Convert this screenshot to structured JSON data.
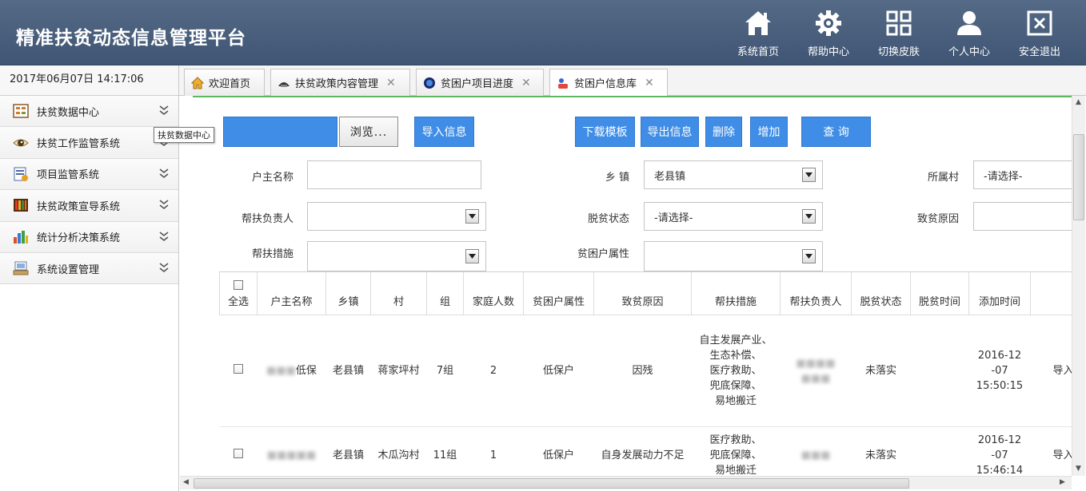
{
  "app": {
    "title": "精准扶贫动态信息管理平台"
  },
  "top_nav": [
    {
      "label": "系统首页",
      "icon": "home-icon"
    },
    {
      "label": "帮助中心",
      "icon": "gear-icon"
    },
    {
      "label": "切换皮肤",
      "icon": "grid-icon"
    },
    {
      "label": "个人中心",
      "icon": "user-icon"
    },
    {
      "label": "安全退出",
      "icon": "close-box-icon"
    }
  ],
  "sidebar": {
    "datetime": "2017年06月07日 14:17:06",
    "items": [
      {
        "label": "扶贫数据中心",
        "icon": "data-center-icon"
      },
      {
        "label": "扶贫工作监管系统",
        "icon": "eye-icon"
      },
      {
        "label": "项目监管系统",
        "icon": "project-icon"
      },
      {
        "label": "扶贫政策宣导系统",
        "icon": "books-icon"
      },
      {
        "label": "统计分析决策系统",
        "icon": "bar-chart-icon"
      },
      {
        "label": "系统设置管理",
        "icon": "settings-icon"
      }
    ],
    "tooltip": "扶贫数据中心"
  },
  "tabs": [
    {
      "label": "欢迎首页",
      "icon": "home-icon",
      "closable": false
    },
    {
      "label": "扶贫政策内容管理",
      "icon": "policy-icon",
      "closable": true
    },
    {
      "label": "贫困户项目进度",
      "icon": "progress-icon",
      "closable": true
    },
    {
      "label": "贫困户信息库",
      "icon": "household-icon",
      "closable": true
    }
  ],
  "toolbar": {
    "browse": "浏览...",
    "import": "导入信息",
    "download_template": "下载模板",
    "export": "导出信息",
    "delete": "删除",
    "add": "增加",
    "query": "查 询"
  },
  "filters": {
    "head_name": {
      "label": "户主名称",
      "value": ""
    },
    "township": {
      "label": "乡 镇",
      "value": "老县镇"
    },
    "village": {
      "label": "所属村",
      "value": "-请选择-"
    },
    "helper": {
      "label": "帮扶负责人",
      "value": ""
    },
    "status": {
      "label": "脱贫状态",
      "value": "-请选择-"
    },
    "cause": {
      "label": "致贫原因",
      "value": ""
    },
    "measures": {
      "label": "帮扶措施",
      "value": ""
    },
    "attribute": {
      "label": "贫困户属性",
      "value": ""
    }
  },
  "table": {
    "headers": [
      "全选",
      "户主名称",
      "乡镇",
      "村",
      "组",
      "家庭人数",
      "贫困户属性",
      "致贫原因",
      "帮扶措施",
      "帮扶负责人",
      "脱贫状态",
      "脱贫时间",
      "添加时间"
    ],
    "rows": [
      {
        "name": "低保",
        "township": "老县镇",
        "village": "蒋家坪村",
        "group": "7组",
        "members": "2",
        "attribute": "低保户",
        "cause": "因残",
        "measures": [
          "自主发展产业、",
          "生态补偿、",
          "医疗救助、",
          "兜底保障、",
          "易地搬迁"
        ],
        "helper": "",
        "status": "未落实",
        "off_time": "",
        "added": [
          "2016-12",
          "-07",
          "15:50:15"
        ],
        "extra": "导入"
      },
      {
        "name": "",
        "township": "老县镇",
        "village": "木瓜沟村",
        "group": "11组",
        "members": "1",
        "attribute": "低保户",
        "cause": "自身发展动力不足",
        "measures": [
          "医疗救助、",
          "兜底保障、",
          "易地搬迁"
        ],
        "helper": "",
        "status": "未落实",
        "off_time": "",
        "added": [
          "2016-12",
          "-07",
          "15:46:14"
        ],
        "extra": "导入"
      }
    ]
  },
  "colors": {
    "header": "#475d7c",
    "button": "#3f8de6",
    "accent_line": "#5fb85f"
  }
}
